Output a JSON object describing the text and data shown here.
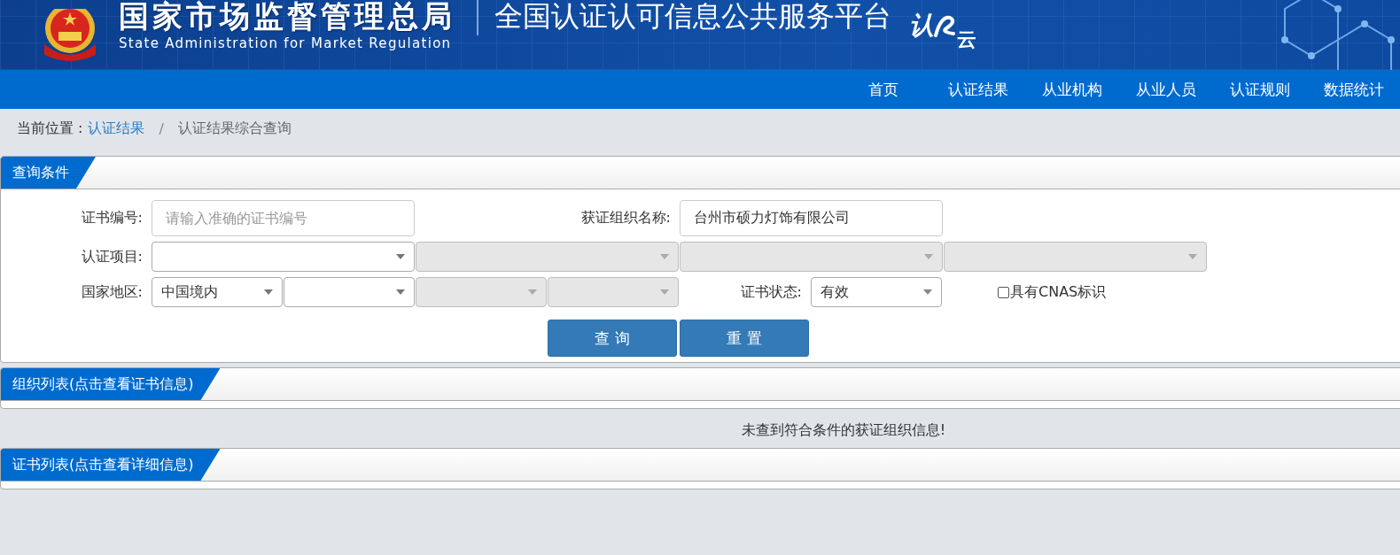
{
  "header": {
    "agency_name": "国家市场监督管理总局",
    "agency_name_en": "State Administration  for  Market Regulation",
    "platform_title": "全国认证认可信息公共服务平台",
    "logo": {
      "top": "认",
      "bottom": "云"
    }
  },
  "nav": [
    {
      "label": "首页"
    },
    {
      "label": "认证结果"
    },
    {
      "label": "从业机构"
    },
    {
      "label": "从业人员"
    },
    {
      "label": "认证规则"
    },
    {
      "label": "数据统计"
    }
  ],
  "breadcrumb": {
    "prefix": "当前位置 :",
    "link": "认证结果",
    "separator": "/",
    "current": "认证结果综合查询"
  },
  "query_panel": {
    "title": "查询条件",
    "cert_number": {
      "label": "证书编号:",
      "placeholder": "请输入准确的证书编号"
    },
    "org_name": {
      "label": "获证组织名称:",
      "value": "台州市硕力灯饰有限公司"
    },
    "cert_project": {
      "label": "认证项目:",
      "selects": [
        {
          "disabled": false
        },
        {
          "disabled": true
        },
        {
          "disabled": true
        },
        {
          "disabled": true
        }
      ]
    },
    "region": {
      "label": "国家地区:",
      "selects": [
        {
          "value": "中国境内",
          "disabled": false
        },
        {
          "disabled": false
        },
        {
          "disabled": true
        },
        {
          "disabled": true
        }
      ]
    },
    "cert_status": {
      "label": "证书状态:",
      "value": "有效"
    },
    "cnas": {
      "label": "具有CNAS标识",
      "checked": false
    },
    "buttons": [
      {
        "label": "查 询"
      },
      {
        "label": "重 置"
      }
    ]
  },
  "org_panel": {
    "title": "组织列表(点击查看证书信息)",
    "empty_message": "未查到符合条件的获证组织信息!"
  },
  "cert_panel": {
    "title": "证书列表(点击查看详细信息)"
  }
}
